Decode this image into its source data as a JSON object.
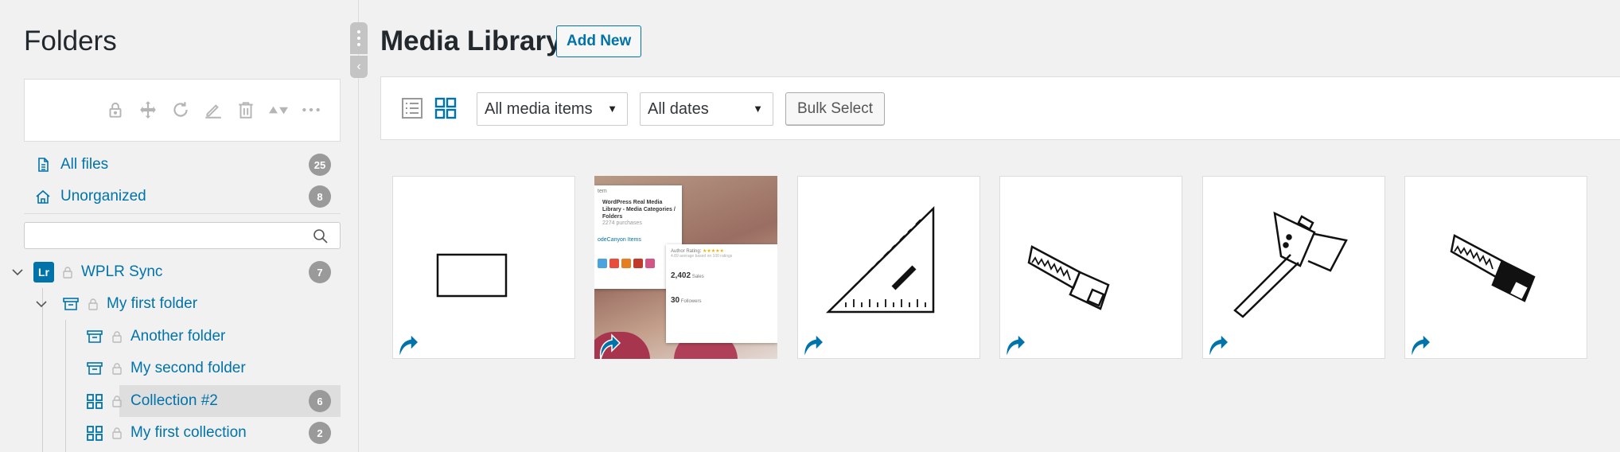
{
  "sidebar": {
    "title": "Folders",
    "toolbar_icons": [
      "lock-icon",
      "move-icon",
      "refresh-icon",
      "pencil-icon",
      "trash-icon",
      "sort-icon",
      "more-icon"
    ],
    "nav": [
      {
        "label": "All files",
        "count": "25",
        "icon": "file-icon"
      },
      {
        "label": "Unorganized",
        "count": "8",
        "icon": "home-icon"
      }
    ],
    "search": {
      "placeholder": "",
      "value": ""
    },
    "tree": [
      {
        "label": "WPLR Sync",
        "badge": "Lr",
        "count": "7"
      },
      {
        "label": "My first folder",
        "count": ""
      },
      {
        "label": "Another folder",
        "count": ""
      },
      {
        "label": "My second folder",
        "count": ""
      },
      {
        "label": "Collection #2",
        "count": "6"
      },
      {
        "label": "My first collection",
        "count": "2"
      }
    ]
  },
  "main": {
    "title": "Media Library",
    "add_new_label": "Add New",
    "filters": {
      "media_type": "All media items",
      "dates": "All dates",
      "bulk_select_label": "Bulk Select"
    },
    "thumbnail_text": {
      "card_line1": "WordPress Real Media Library - Media Categories / Folders",
      "card_line2": "2274 purchases",
      "card_link": "odeCanyon Items",
      "item_label": "tem",
      "rating_label": "Author Rating:",
      "rating_stars": "★★★★★",
      "rating_note": "4.89 average based on 100 ratings",
      "sales": "2,402",
      "sales_label": "Sales",
      "followers": "30",
      "followers_label": "Followers"
    },
    "media_items": [
      {
        "type": "rectangle-icon"
      },
      {
        "type": "screenshot-thumbnail"
      },
      {
        "type": "set-square-icon"
      },
      {
        "type": "saw-icon"
      },
      {
        "type": "axe-icon"
      },
      {
        "type": "saw-icon"
      }
    ]
  },
  "colors": {
    "accent": "#0073aa",
    "badge": "#9a9a9a",
    "background": "#f1f1f1"
  }
}
